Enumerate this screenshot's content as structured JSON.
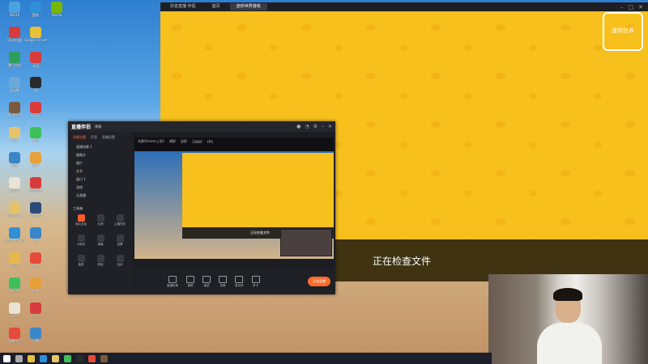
{
  "desktop": {
    "icons": [
      {
        "label": "Win10",
        "color": "#4aa3df"
      },
      {
        "label": "QQ浏览器",
        "color": "#d83b3b"
      },
      {
        "label": "腾讯文档",
        "color": "#2e9e5b"
      },
      {
        "label": "此电脑",
        "color": "#6aa9d9"
      },
      {
        "label": "Minecraft",
        "color": "#7a5a3a"
      },
      {
        "label": "文件",
        "color": "#e6c36a"
      },
      {
        "label": "网络",
        "color": "#3a86c8"
      },
      {
        "label": "Zoom",
        "color": "#e8e3d3"
      },
      {
        "label": "Project_1",
        "color": "#e6c36a"
      },
      {
        "label": "Microsoft Edge",
        "color": "#2f8fd8"
      },
      {
        "label": "WPS",
        "color": "#e6b84a"
      },
      {
        "label": "WeGame",
        "color": "#3fbf5a"
      },
      {
        "label": "Boss",
        "color": "#e8e3d3"
      },
      {
        "label": "直播伴侣",
        "color": "#e64a3a"
      },
      {
        "label": "酷狗",
        "color": "#2f8fd8"
      },
      {
        "label": "Google Chrome",
        "color": "#e8c03a"
      },
      {
        "label": "云盘",
        "color": "#d83b3b"
      },
      {
        "label": "QQ",
        "color": "#2a2a2a"
      },
      {
        "label": "网易云",
        "color": "#d83b3b"
      },
      {
        "label": "微信",
        "color": "#3fbf5a"
      },
      {
        "label": "原神",
        "color": "#e8a03a"
      },
      {
        "label": "网易游戏",
        "color": "#d83b3b"
      },
      {
        "label": "Steam",
        "color": "#2a4a7a"
      },
      {
        "label": "PR",
        "color": "#3a86c8"
      },
      {
        "label": "Word",
        "color": "#e64a3a"
      },
      {
        "label": "剪映",
        "color": "#e8a03a"
      },
      {
        "label": "PS",
        "color": "#d83b3b"
      },
      {
        "label": "迅雷",
        "color": "#3a86c8"
      },
      {
        "label": "Nvidia",
        "color": "#76b900"
      }
    ]
  },
  "big_window": {
    "tabs": [
      {
        "label": "抖音直播 伴侣"
      },
      {
        "label": "首页"
      },
      {
        "label": "迷你世界游戏"
      }
    ],
    "active_tab": 2,
    "status_text": "正在检查文件",
    "logo_text": "迷你世界"
  },
  "app_window": {
    "brand": "直播伴侣",
    "version": "9.6",
    "left_tabs": [
      {
        "label": "场景设置",
        "active": true
      },
      {
        "label": "声音",
        "active": false
      },
      {
        "label": "直播设置",
        "active": false
      }
    ],
    "scenes": [
      {
        "label": "直播场景 1"
      },
      {
        "label": "摄像头"
      },
      {
        "label": "图片"
      },
      {
        "label": "文字"
      },
      {
        "label": "窗口 1"
      },
      {
        "label": "游戏"
      },
      {
        "label": "无直播"
      }
    ],
    "tools_title": "工具箱",
    "tools": [
      {
        "label": "观众互动"
      },
      {
        "label": "礼物"
      },
      {
        "label": "主播任务"
      },
      {
        "label": "小助手"
      },
      {
        "label": "弹幕"
      },
      {
        "label": "投票"
      },
      {
        "label": "抽奖"
      },
      {
        "label": "商品"
      },
      {
        "label": "活动"
      }
    ],
    "preview_toolbar": [
      {
        "label": "场景Stream上场1"
      },
      {
        "label": "横屏"
      },
      {
        "label": "竖屏"
      },
      {
        "label": "1080P"
      },
      {
        "label": "FPS"
      }
    ],
    "preview_bar_text": "正在检查文件",
    "bottom_tools": [
      {
        "label": "直播布局"
      },
      {
        "label": "美颜"
      },
      {
        "label": "画质"
      },
      {
        "label": "录屏"
      },
      {
        "label": "麦克风"
      },
      {
        "label": "声卡"
      }
    ],
    "go_live_label": "开始直播"
  },
  "taskbar": {
    "icons": [
      {
        "name": "start",
        "color": "#ffffff"
      },
      {
        "name": "search",
        "color": "#aaaaaa"
      },
      {
        "name": "chrome",
        "color": "#e8c03a"
      },
      {
        "name": "edge",
        "color": "#2f8fd8"
      },
      {
        "name": "explorer",
        "color": "#e6c36a"
      },
      {
        "name": "wechat",
        "color": "#3fbf5a"
      },
      {
        "name": "qq",
        "color": "#2a2a2a"
      },
      {
        "name": "live",
        "color": "#e64a3a"
      },
      {
        "name": "minecraft",
        "color": "#7a5a3a"
      }
    ]
  }
}
